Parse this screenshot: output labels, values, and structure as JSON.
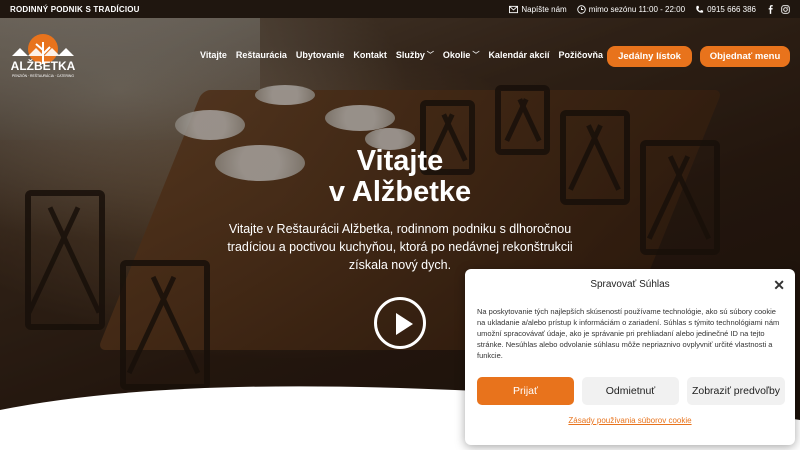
{
  "topbar": {
    "tagline": "RODINNÝ PODNIK S TRADÍCIOU",
    "email_label": "Napíšte nám",
    "hours_label": "mimo sezónu 11:00 - 22:00",
    "phone_label": "0915 666 386"
  },
  "logo": {
    "name": "ALŽBETKA",
    "subline": "PENZIÓN · REŠTAURÁCIA · CATERING"
  },
  "nav": {
    "items": [
      {
        "label": "Vitajte"
      },
      {
        "label": "Reštaurácia"
      },
      {
        "label": "Ubytovanie"
      },
      {
        "label": "Kontakt"
      },
      {
        "label": "Služby"
      },
      {
        "label": "Okolie"
      },
      {
        "label": "Kalendár akcií"
      },
      {
        "label": "Požičovňa"
      }
    ],
    "menu_button": "Jedálny lístok",
    "order_button": "Objednať menu"
  },
  "hero": {
    "heading_line1": "Vitajte",
    "heading_line2": "v Alžbetke",
    "intro": "Vitajte v Reštaurácii Alžbetka, rodinnom podniku s dlhoročnou tradíciou a poctivou kuchyňou, ktorá po nedávnej rekonštrukcii získala nový dych."
  },
  "cookie": {
    "title": "Spravovať Súhlas",
    "text": "Na poskytovanie tých najlepších skúseností používame technológie, ako sú súbory cookie na ukladanie a/alebo prístup k informáciám o zariadení. Súhlas s týmito technológiami nám umožní spracovávať údaje, ako je správanie pri prehliadaní alebo jedinečné ID na tejto stránke. Nesúhlas alebo odvolanie súhlasu môže nepriaznivo ovplyvniť určité vlastnosti a funkcie.",
    "accept": "Prijať",
    "deny": "Odmietnuť",
    "preferences": "Zobraziť predvoľby",
    "policy": "Zásady používania súborov cookie",
    "close": "✕"
  },
  "colors": {
    "accent": "#e8731c",
    "topbar_bg": "#1f160f"
  }
}
